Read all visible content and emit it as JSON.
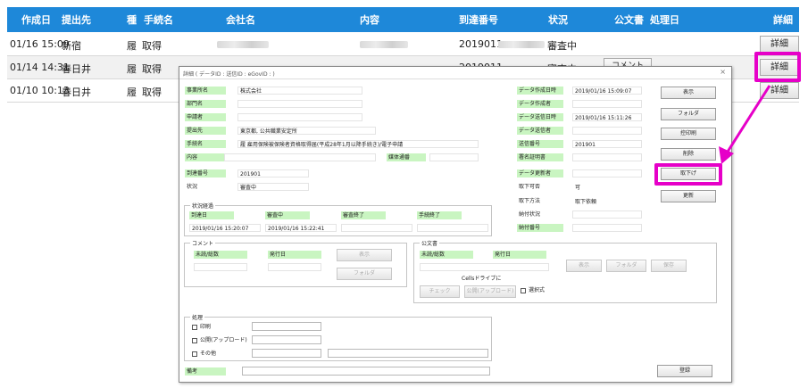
{
  "list": {
    "headers": {
      "created": "作成日",
      "dest": "提出先",
      "kind": "種",
      "proc": "手続名",
      "company": "会社名",
      "content": "内容",
      "arrival": "到達番号",
      "status": "状況",
      "doc": "公文書",
      "procdate": "処理日",
      "detail": "詳細"
    },
    "rows": [
      {
        "date": "01/16 15:09",
        "dest": "新宿",
        "kind": "履",
        "proc": "取得",
        "arrival": "2019011",
        "status": "審査中",
        "doc": "",
        "detail": "詳細"
      },
      {
        "date": "01/14 14:31",
        "dest": "春日井",
        "kind": "履",
        "proc": "取得",
        "arrival": "2019011",
        "status": "審査中",
        "doc": "コメント",
        "detail": "詳細"
      },
      {
        "date": "01/10 10:13",
        "dest": "春日井",
        "kind": "履",
        "proc": "取得",
        "arrival": "",
        "status": "",
        "doc": "",
        "detail": "詳細"
      }
    ]
  },
  "dialog": {
    "title": "詳細 ( データID :                         送信ID :                                  eGovID :                              )",
    "close": "×",
    "left_fields": [
      {
        "label": "事業所名",
        "value": "株式会社"
      },
      {
        "label": "部門名",
        "value": ""
      },
      {
        "label": "申請者",
        "value": ""
      },
      {
        "label": "提出先",
        "value": "東京都,      公共職業安定所"
      },
      {
        "label": "手続名",
        "value": "履  雇用保険被保険者資格取得届(平成28年1月以降手続き)/電子申請"
      },
      {
        "label": "内容",
        "value": ""
      },
      {
        "label": "到達番号",
        "value": "201901"
      },
      {
        "label": "状況",
        "value": "審査中"
      }
    ],
    "media_label": "媒体通番",
    "right_fields": [
      {
        "label": "データ作成日時",
        "value": "2019/01/16 15:09:07"
      },
      {
        "label": "データ作成者",
        "value": ""
      },
      {
        "label": "データ送信日時",
        "value": "2019/01/16 15:11:26"
      },
      {
        "label": "データ送信者",
        "value": ""
      },
      {
        "label": "送信番号",
        "value": "201901"
      },
      {
        "label": "署名証明書",
        "value": ""
      },
      {
        "label": "データ更新者",
        "value": ""
      },
      {
        "label": "取下可否",
        "value": "可"
      },
      {
        "label": "取下方法",
        "value": "取下依頼"
      },
      {
        "label": "納付状況",
        "value": ""
      },
      {
        "label": "納付番号",
        "value": ""
      }
    ],
    "side_buttons": [
      "表示",
      "フォルダ",
      "控印刷",
      "削除",
      "取下げ",
      "更新"
    ],
    "progress": {
      "title": "状況経過",
      "columns": [
        "到達日",
        "審査中",
        "審査終了",
        "手続終了"
      ],
      "values": [
        "2019/01/16 15:20:07",
        "2019/01/16 15:22:41",
        "",
        ""
      ]
    },
    "comment": {
      "title": "コメント",
      "unread_label": "未読/総数",
      "issue_label": "発行日",
      "show": "表示",
      "folder": "フォルダ"
    },
    "official": {
      "title": "公文書",
      "unread_label": "未読/総数",
      "issue_label": "発行日",
      "show": "表示",
      "folder": "フォルダ",
      "save": "保存",
      "cells_label": "Cellsドライブに",
      "check": "チェック",
      "publish": "公開(アップロード)",
      "select": "選択式"
    },
    "process": {
      "title": "処理",
      "print": "印刷",
      "upload": "公開(アップロード)",
      "other": "その他"
    },
    "note_label": "備考",
    "register": "登録"
  },
  "colors": {
    "header": "#1e88d9",
    "highlight": "#e600c8",
    "label_bg": "#c9f5c1"
  }
}
